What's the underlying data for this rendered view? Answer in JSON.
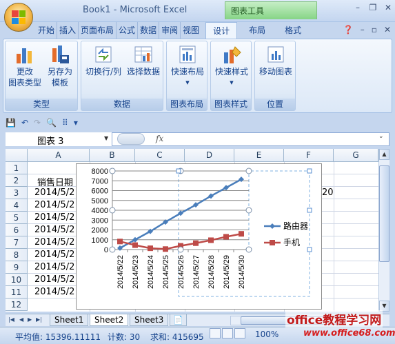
{
  "window": {
    "title": "Book1 - Microsoft Excel",
    "tools_tab": "图表工具"
  },
  "tabs": [
    "开始",
    "插入",
    "页面布局",
    "公式",
    "数据",
    "审阅",
    "视图",
    "设计",
    "布局",
    "格式"
  ],
  "ribbon": {
    "groups": [
      {
        "label": "类型",
        "buttons": [
          {
            "line1": "更改",
            "line2": "图表类型"
          },
          {
            "line1": "另存为",
            "line2": "模板"
          }
        ]
      },
      {
        "label": "数据",
        "buttons": [
          {
            "line1": "切换行/列",
            "line2": ""
          },
          {
            "line1": "选择数据",
            "line2": ""
          }
        ]
      },
      {
        "label": "图表布局",
        "buttons": [
          {
            "line1": "快速布局",
            "line2": ""
          }
        ]
      },
      {
        "label": "图表样式",
        "buttons": [
          {
            "line1": "快速样式",
            "line2": ""
          }
        ]
      },
      {
        "label": "位置",
        "buttons": [
          {
            "line1": "移动图表",
            "line2": ""
          }
        ]
      }
    ]
  },
  "formula_bar": {
    "name_box": "图表 3",
    "fx": "fx"
  },
  "columns": [
    "A",
    "B",
    "C",
    "D",
    "E",
    "F",
    "G"
  ],
  "rows": [
    "1",
    "2",
    "3",
    "4",
    "5",
    "6",
    "7",
    "8",
    "9",
    "10",
    "11",
    "12"
  ],
  "cells": {
    "A2": "销售日期",
    "A3": "2014/5/2",
    "A4": "2014/5/2",
    "A5": "2014/5/2",
    "A6": "2014/5/2",
    "A7": "2014/5/2",
    "A8": "2014/5/2",
    "A9": "2014/5/2",
    "A10": "2014/5/2",
    "A11": "2014/5/2",
    "F3": "20"
  },
  "chart_data": {
    "type": "line",
    "categories": [
      "2014/5/22",
      "2014/5/23",
      "2014/5/24",
      "2014/5/25",
      "2014/5/26",
      "2014/5/27",
      "2014/5/28",
      "2014/5/29",
      "2014/5/30"
    ],
    "series": [
      {
        "name": "路由器",
        "values": [
          150,
          1000,
          1850,
          2800,
          3700,
          4550,
          5450,
          6300,
          7150
        ],
        "color": "#4a7ebb",
        "marker": "diamond"
      },
      {
        "name": "手机",
        "values": [
          820,
          450,
          130,
          50,
          380,
          650,
          950,
          1300,
          1600
        ],
        "color": "#be4b48",
        "marker": "square"
      }
    ],
    "ylim": [
      0,
      8000
    ],
    "yticks": [
      "0",
      "1000",
      "2000",
      "3000",
      "4000",
      "5000",
      "6000",
      "7000",
      "8000"
    ],
    "grid": true,
    "legend": "right"
  },
  "sheet_tabs": [
    "Sheet1",
    "Sheet2",
    "Sheet3"
  ],
  "active_sheet": "Sheet2",
  "status": {
    "average": "平均值: 15396.11111",
    "count": "计数: 30",
    "sum": "求和: 415695",
    "zoom": "100%"
  },
  "watermark": {
    "line1": "office教程学习网",
    "line2": "www.office68.com"
  }
}
